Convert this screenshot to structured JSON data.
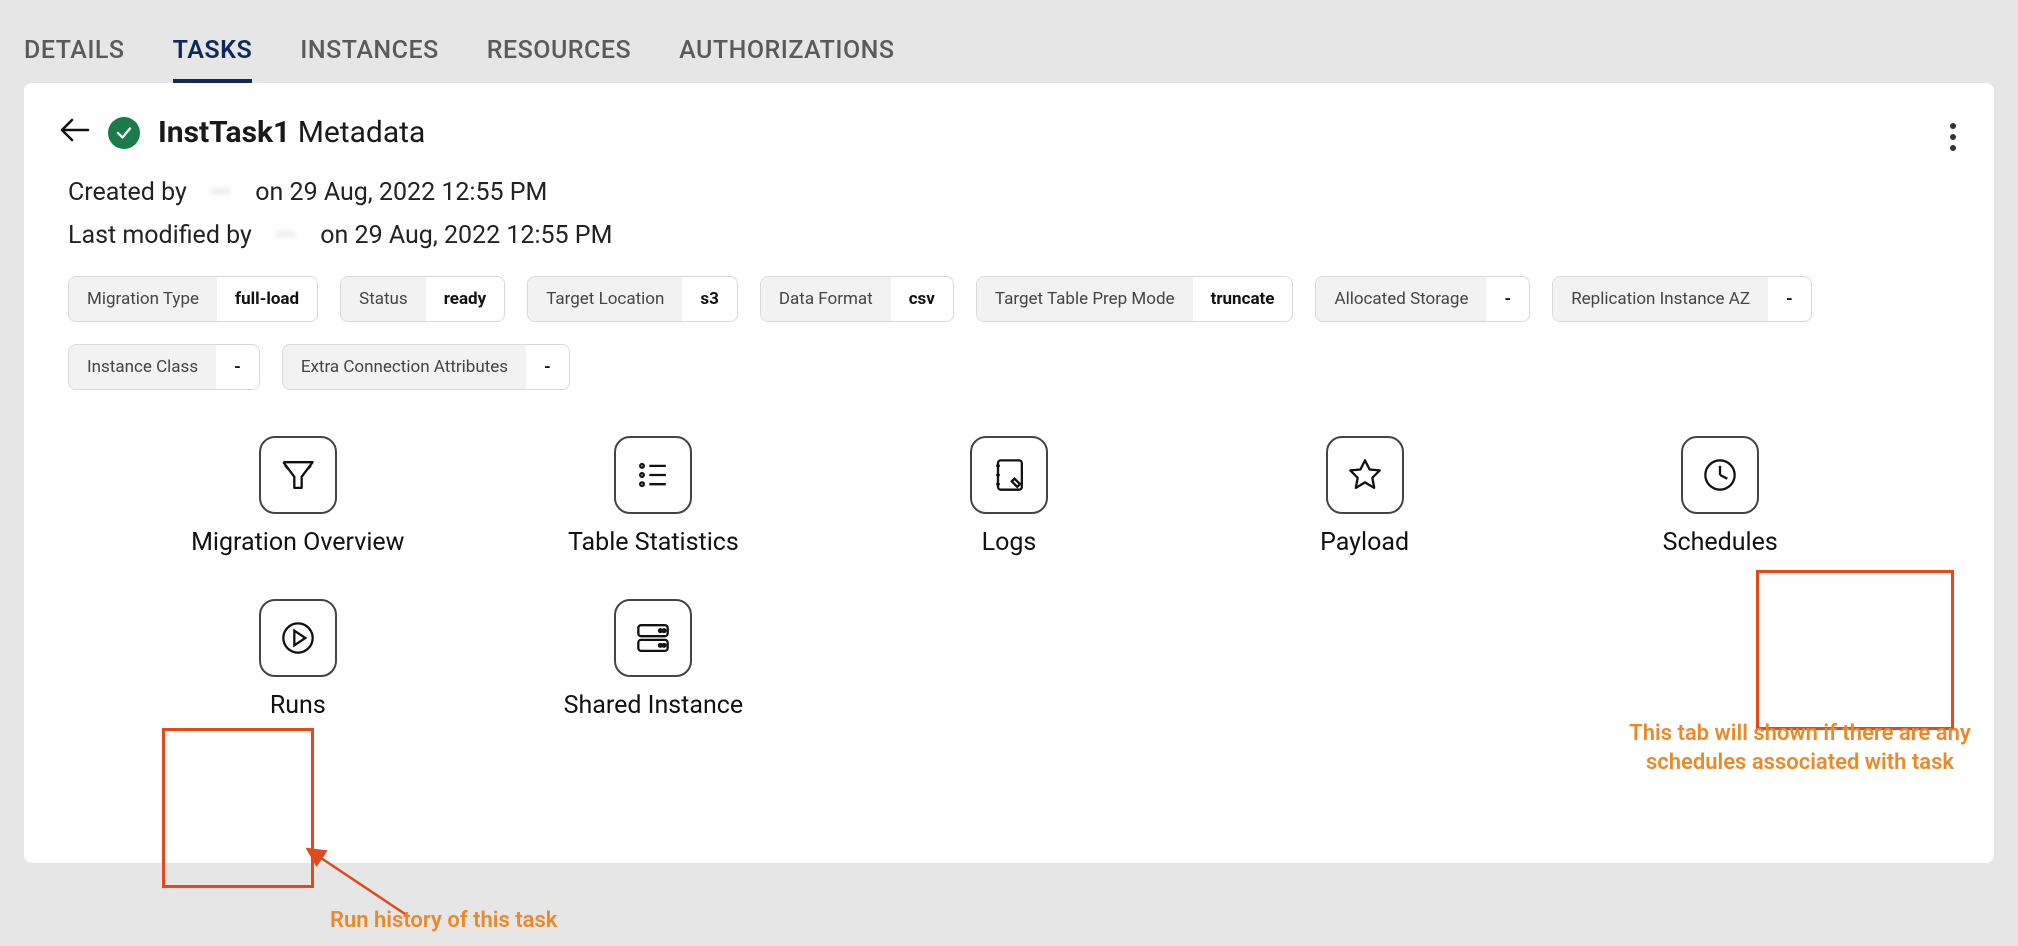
{
  "tabs": {
    "details": "DETAILS",
    "tasks": "TASKS",
    "instances": "INSTANCES",
    "resources": "RESOURCES",
    "authorizations": "AUTHORIZATIONS"
  },
  "header": {
    "title_bold": "InstTask1",
    "title_rest": " Metadata"
  },
  "meta": {
    "created_prefix": "Created by ",
    "created_user": "···",
    "created_suffix": " on 29 Aug, 2022 12:55 PM",
    "modified_prefix": "Last modified by ",
    "modified_user": "···",
    "modified_suffix": " on 29 Aug, 2022 12:55 PM"
  },
  "pills": {
    "migration_type": {
      "label": "Migration Type",
      "value": "full-load"
    },
    "status": {
      "label": "Status",
      "value": "ready"
    },
    "target_location": {
      "label": "Target Location",
      "value": "s3"
    },
    "data_format": {
      "label": "Data Format",
      "value": "csv"
    },
    "prep_mode": {
      "label": "Target Table Prep Mode",
      "value": "truncate"
    },
    "allocated_storage": {
      "label": "Allocated Storage",
      "value": "-"
    },
    "replication_az": {
      "label": "Replication Instance AZ",
      "value": "-"
    },
    "instance_class": {
      "label": "Instance Class",
      "value": "-"
    },
    "extra_conn": {
      "label": "Extra Connection Attributes",
      "value": "-"
    }
  },
  "tiles": {
    "migration_overview": "Migration Overview",
    "table_statistics": "Table Statistics",
    "logs": "Logs",
    "payload": "Payload",
    "schedules": "Schedules",
    "runs": "Runs",
    "shared_instance": "Shared Instance"
  },
  "annotations": {
    "runs": "Run history of this task",
    "schedules": "This tab will shown if there are any schedules associated with task"
  }
}
